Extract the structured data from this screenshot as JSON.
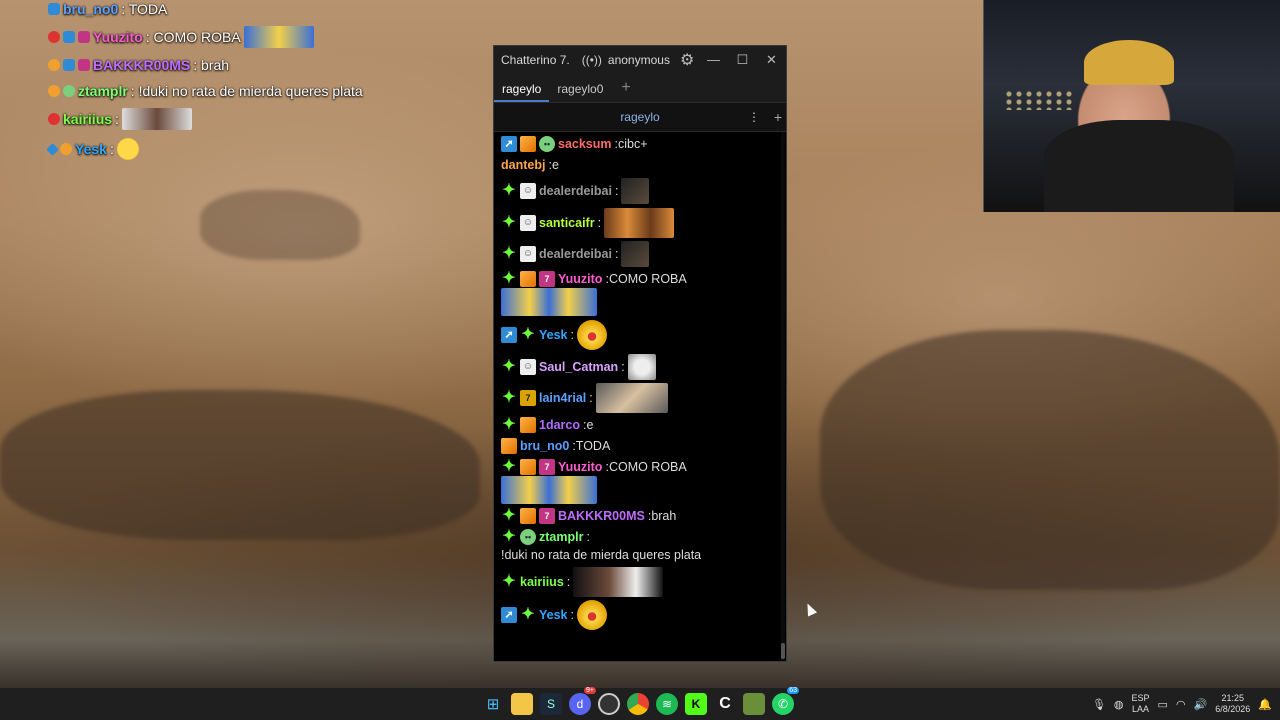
{
  "overlay": {
    "lines": [
      {
        "user": "bru_no0",
        "text": ": TODA",
        "color": "#5aa0ff"
      },
      {
        "user": "Yuuzito",
        "text": ": COMO ROBA",
        "color": "#ff5bd0"
      },
      {
        "user": "BAKKKR00MS",
        "text": ": brah",
        "color": "#c06cff"
      },
      {
        "user": "ztamplr",
        "text": ": !duki no rata de mierda queres plata",
        "color": "#7cff72"
      },
      {
        "user": "kairiius",
        "text": ":",
        "color": "#7cff4a"
      },
      {
        "user": "Yesk",
        "text": ":",
        "color": "#2fa7ff"
      }
    ]
  },
  "window": {
    "title": "Chatterino 7.",
    "account": "anonymous",
    "tabs": [
      "rageylo",
      "rageylo0"
    ],
    "split_channel": "rageylo",
    "messages": [
      {
        "user": "sacksum",
        "text": "cibc+",
        "color": "#ff6b6b"
      },
      {
        "user": "dantebj",
        "text": "e",
        "color": "#ffa64d"
      },
      {
        "user": "dealerdeibai",
        "text": "",
        "color": "#9a9a9a"
      },
      {
        "user": "santicaifr",
        "text": "",
        "color": "#b7ff3b"
      },
      {
        "user": "dealerdeibai",
        "text": "",
        "color": "#9a9a9a"
      },
      {
        "user": "Yuuzito",
        "text": "COMO ROBA",
        "color": "#ff5bd0"
      },
      {
        "user": "Yesk",
        "text": "",
        "color": "#2fa7ff"
      },
      {
        "user": "Saul_Catman",
        "text": "",
        "color": "#d8a0ff"
      },
      {
        "user": "lain4rial",
        "text": "",
        "color": "#5aa0ff"
      },
      {
        "user": "1darco",
        "text": "e",
        "color": "#b26bff"
      },
      {
        "user": "bru_no0",
        "text": "TODA",
        "color": "#5aa0ff"
      },
      {
        "user": "Yuuzito",
        "text": "COMO ROBA",
        "color": "#ff5bd0"
      },
      {
        "user": "BAKKKR00MS",
        "text": "brah",
        "color": "#c06cff"
      },
      {
        "user": "ztamplr",
        "text": "!duki no rata de mierda queres plata",
        "color": "#7cff72"
      },
      {
        "user": "kairiius",
        "text": "",
        "color": "#7cff4a"
      },
      {
        "user": "Yesk",
        "text": "",
        "color": "#2fa7ff"
      }
    ]
  },
  "taskbar": {
    "lang": "ESP",
    "lang_sub": "LAA",
    "time": "21:25",
    "date": "6/8/2026",
    "badge_discord": "9+",
    "badge_whatsapp": "63"
  }
}
